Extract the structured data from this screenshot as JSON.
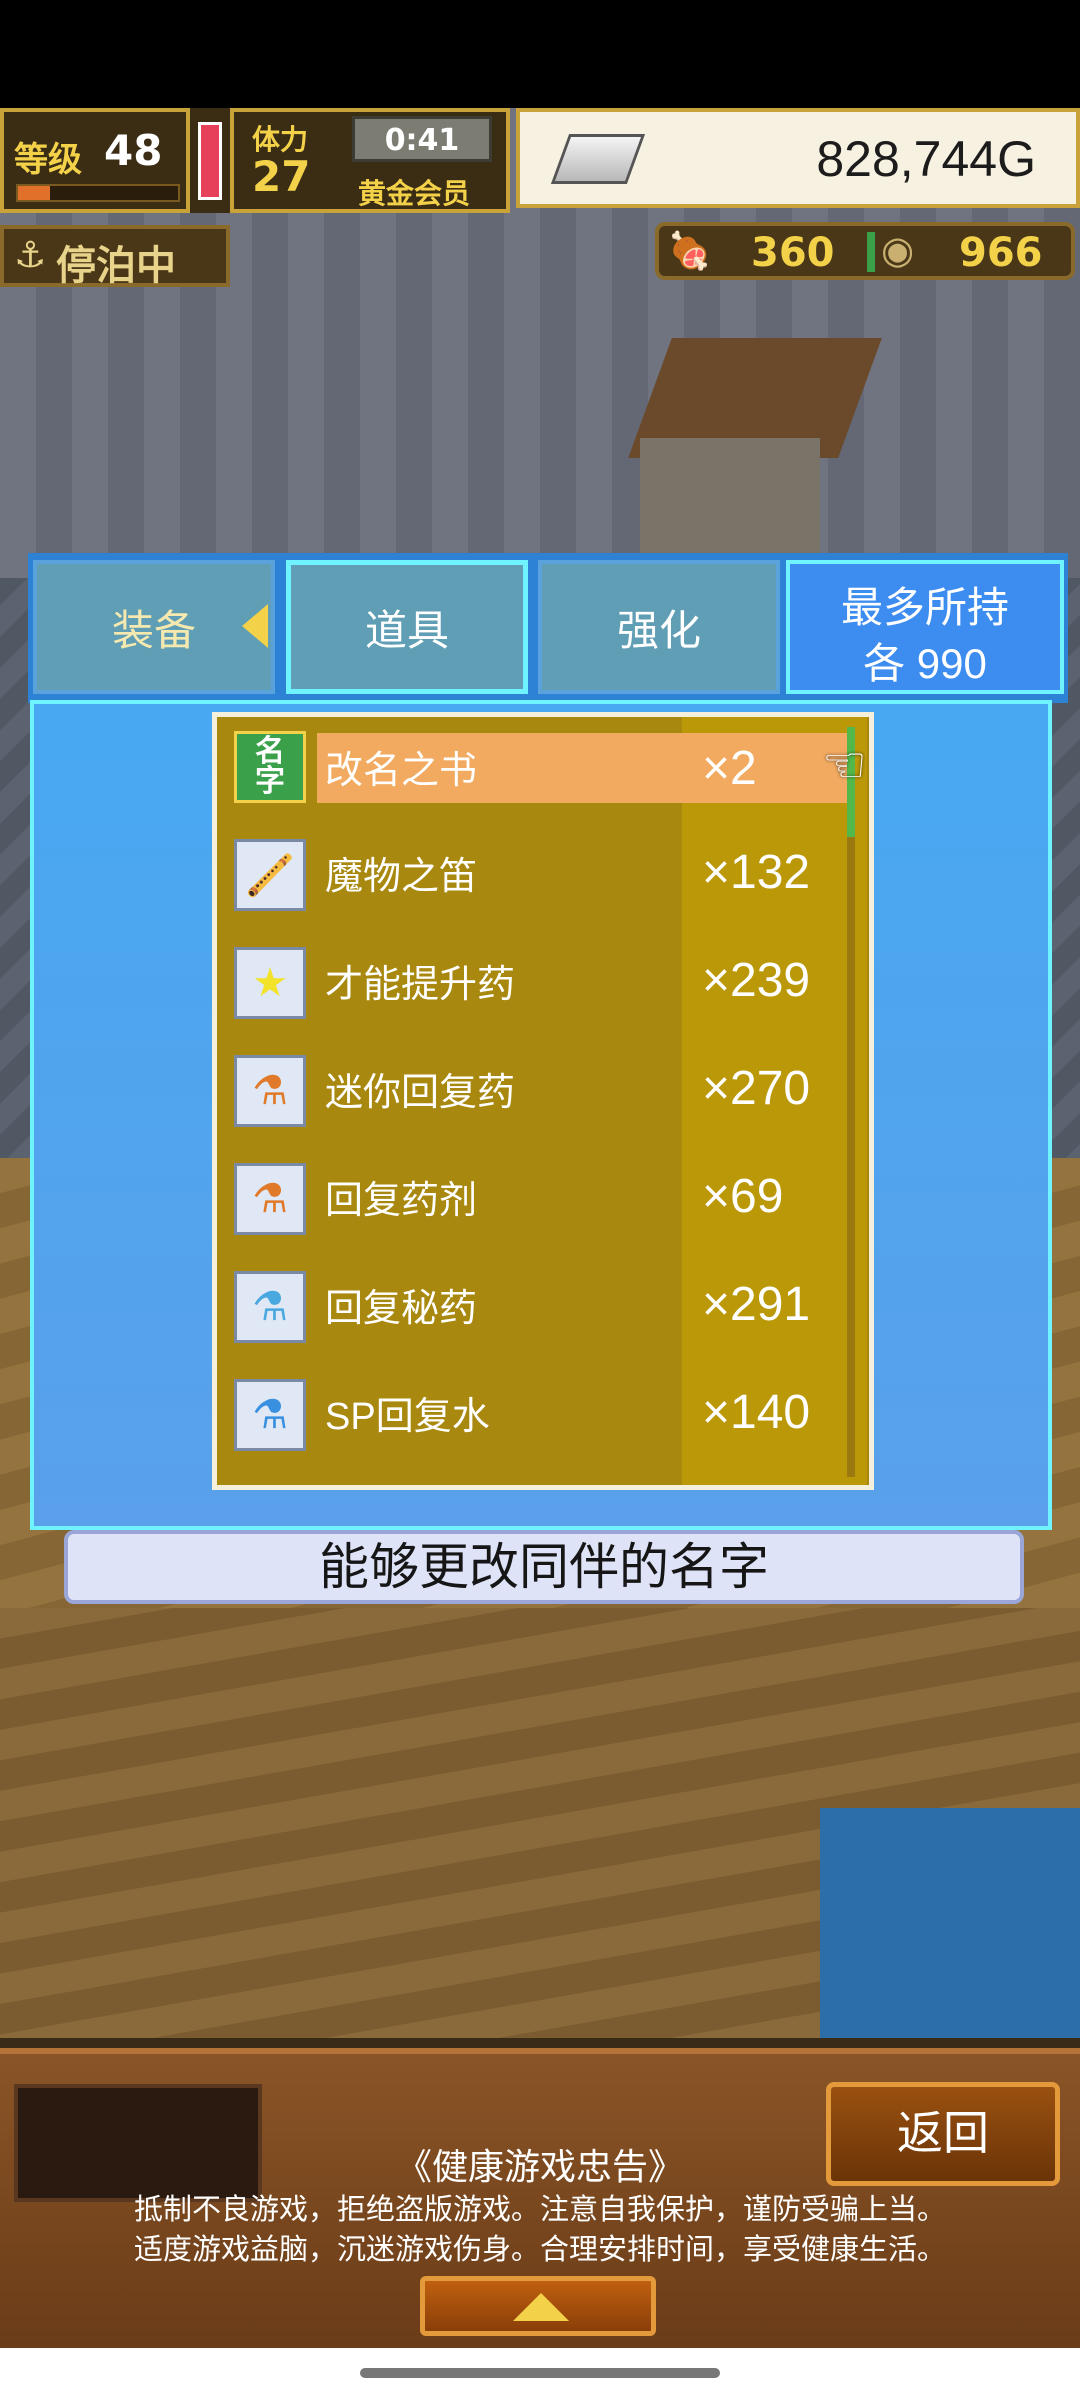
{
  "hud": {
    "level_label": "等级",
    "level": "48",
    "level_progress": 0.2,
    "stamina_label": "体力",
    "stamina": "27",
    "timer": "0:41",
    "membership": "黄金会员",
    "gold": "828,744G",
    "moored": "停泊中",
    "food": "360",
    "medals": "966"
  },
  "tabs": {
    "equipment": "装备",
    "items": "道具",
    "enhance": "强化",
    "max_hold_line1": "最多所持",
    "max_hold_line2": "各 990"
  },
  "items": [
    {
      "name": "改名之书",
      "qty": "×2",
      "icon": "名字",
      "selected": true
    },
    {
      "name": "魔物之笛",
      "qty": "×132",
      "icon": "flute-icon"
    },
    {
      "name": "才能提升药",
      "qty": "×239",
      "icon": "star-icon"
    },
    {
      "name": "迷你回复药",
      "qty": "×270",
      "icon": "mini-potion-icon"
    },
    {
      "name": "回复药剂",
      "qty": "×69",
      "icon": "potion-icon"
    },
    {
      "name": "回复秘药",
      "qty": "×291",
      "icon": "secret-potion-icon"
    },
    {
      "name": "SP回复水",
      "qty": "×140",
      "icon": "sp-water-icon"
    }
  ],
  "description": "能够更改同伴的名字",
  "bottom": {
    "back": "返回",
    "notice_title": "《健康游戏忠告》",
    "notice_line1": "抵制不良游戏，拒绝盗版游戏。注意自我保护，谨防受骗上当。",
    "notice_line2": "适度游戏益脑，沉迷游戏伤身。合理安排时间，享受健康生活。"
  },
  "colors": {
    "panel_blue": "#48a8f2",
    "list_gold": "#a8880e",
    "highlight_orange": "#f1aa60",
    "tab_border_active": "#6ef3ff"
  }
}
